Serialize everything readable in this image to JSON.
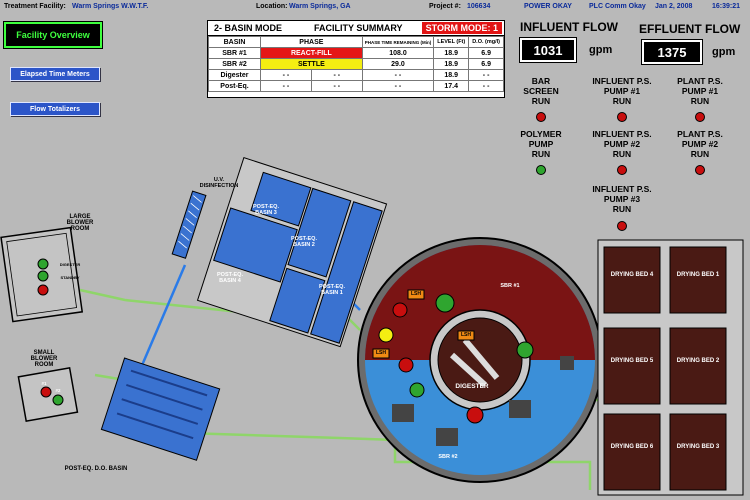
{
  "header": {
    "facility_label": "Treatment Facility:",
    "facility_value": "Warm Springs W.W.T.F.",
    "location_label": "Location:",
    "location_value": "Warm Springs, GA",
    "project_label": "Project #:",
    "project_value": "106634",
    "power_status": "POWER OKAY",
    "plc_status": "PLC Comm Okay",
    "date": "Jan  2, 2008",
    "time": "16:39:21"
  },
  "nav": {
    "overview_label": "Facility Overview",
    "elapsed_label": "Elapsed Time Meters",
    "totalizers_label": "Flow Totalizers"
  },
  "summary": {
    "mode": "2- BASIN MODE",
    "title": "FACILITY SUMMARY",
    "storm": "STORM MODE: 1",
    "columns": [
      "BASIN",
      "PHASE",
      "PHASE TIME REMAINING (Min)",
      "LEVEL (Ft)",
      "D.O. (mg/l)"
    ],
    "rows": [
      {
        "basin": "SBR #1",
        "phase": "REACT-FILL",
        "time": "108.0",
        "level": "18.9",
        "do": "6.9"
      },
      {
        "basin": "SBR #2",
        "phase": "SETTLE",
        "time": "29.0",
        "level": "18.9",
        "do": "6.9"
      },
      {
        "basin": "Digester",
        "phase": "- -",
        "phase2": "- -",
        "time": "- -",
        "level": "18.9",
        "do": "- -"
      },
      {
        "basin": "Post-Eq.",
        "phase": "- -",
        "phase2": "- -",
        "time": "- -",
        "level": "17.4",
        "do": "- -"
      }
    ]
  },
  "flows": {
    "influent_title": "INFLUENT FLOW",
    "influent_value": "1031",
    "effluent_title": "EFFLUENT FLOW",
    "effluent_value": "1375",
    "unit": "gpm"
  },
  "status": {
    "bar_screen": [
      "BAR",
      "SCREEN",
      "RUN"
    ],
    "influent_1": [
      "INFLUENT P.S.",
      "PUMP #1",
      "RUN"
    ],
    "plant_1": [
      "PLANT P.S.",
      "PUMP #1",
      "RUN"
    ],
    "polymer": [
      "POLYMER",
      "PUMP",
      "RUN"
    ],
    "influent_2": [
      "INFLUENT P.S.",
      "PUMP #2",
      "RUN"
    ],
    "plant_2": [
      "PLANT P.S.",
      "PUMP #2",
      "RUN"
    ],
    "influent_3": [
      "INFLUENT P.S.",
      "PUMP #3",
      "RUN"
    ]
  },
  "map": {
    "uv": [
      "U.V.",
      "DISINFECTION"
    ],
    "large_blower": [
      "LARGE",
      "BLOWER",
      "ROOM"
    ],
    "small_blower": [
      "SMALL",
      "BLOWER",
      "ROOM"
    ],
    "digester_lbl": "DIGESTER",
    "standby_lbl": "STANDBY",
    "post_eq_3": [
      "POST-EQ.",
      "BASIN 3"
    ],
    "post_eq_2": [
      "POST-EQ.",
      "BASIN 2"
    ],
    "post_eq_4": [
      "POST-EQ.",
      "BASIN 4"
    ],
    "post_eq_1": [
      "POST-EQ.",
      "BASIN 1"
    ],
    "sbr1": "SBR #1",
    "sbr2": "SBR #2",
    "digester": "DIGESTER",
    "lsh": "LSH",
    "do_basin": "POST-EQ. D.O. BASIN",
    "blower1": "#1",
    "blower2": "#2"
  },
  "drying_beds": [
    "DRYING BED 4",
    "DRYING BED 1",
    "DRYING BED 5",
    "DRYING BED 2",
    "DRYING BED 6",
    "DRYING BED 3"
  ],
  "colors": {
    "sbr1": "#7a1414",
    "sbr2": "#3b8fd8",
    "post_eq": "#3a72d0",
    "drying": "#4a1a14",
    "pipe": "#8fd56a"
  }
}
